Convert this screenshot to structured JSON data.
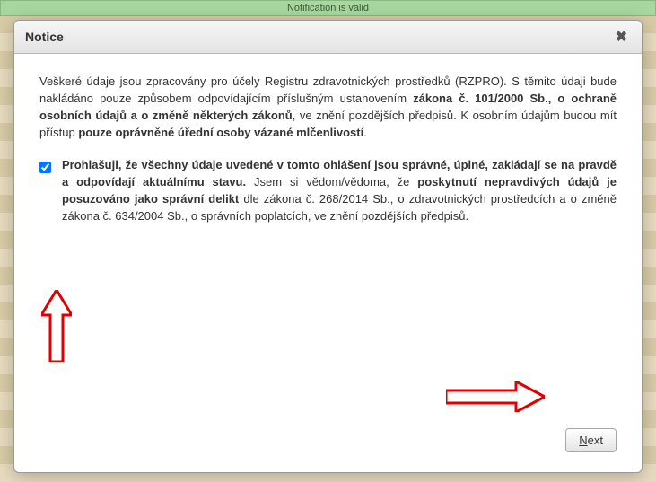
{
  "banner": {
    "text": "Notification is valid"
  },
  "modal": {
    "title": "Notice",
    "intro": {
      "p1a": "Veškeré údaje jsou zpracovány pro účely Registru zdravotnických prostředků (RZPRO). S těmito údaji bude nakládáno pouze způsobem odpovídajícím příslušným ustanovením ",
      "p1b_bold": "zákona č. 101/2000 Sb., o ochraně osobních údajů a o změně některých zákonů",
      "p1c": ", ve znění pozdějších předpisů. K osobním údajům budou mít přístup ",
      "p1d_bold": "pouze oprávněné úřední osoby vázané mlčenlivostí",
      "p1e": "."
    },
    "declaration": {
      "d1_bold": "Prohlašuji, že všechny údaje uvedené v tomto ohlášení jsou správné, úplné, zakládají se na pravdě a odpovídají aktuálnímu stavu.",
      "d2": " Jsem si vědom/vědoma, že ",
      "d3_bold": "poskytnutí nepravdivých údajů je posuzováno jako správní delikt",
      "d4": " dle zákona č. 268/2014 Sb., o zdravotnických prostředcích a o změně zákona č. 634/2004 Sb., o správních poplatcích, ve znění pozdějších předpisů."
    },
    "next_first": "N",
    "next_rest": "ext"
  }
}
